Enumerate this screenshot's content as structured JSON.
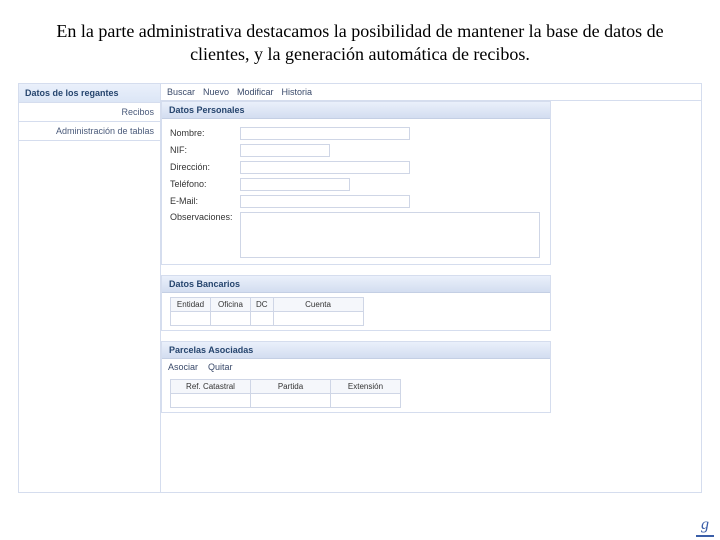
{
  "caption": "En la parte administrativa destacamos la posibilidad de mantener la base de datos de clientes, y la generación automática de recibos.",
  "sidebar": {
    "header": "Datos de los regantes",
    "items": [
      "Recibos",
      "Administración de tablas"
    ]
  },
  "toolbar": {
    "buscar": "Buscar",
    "nuevo": "Nuevo",
    "modificar": "Modificar",
    "historia": "Historia"
  },
  "sections": {
    "personales": "Datos Personales",
    "bancarios": "Datos Bancarios",
    "parcelas": "Parcelas Asociadas"
  },
  "form": {
    "nombre": "Nombre:",
    "nif": "NIF:",
    "direccion": "Dirección:",
    "telefono": "Teléfono:",
    "email": "E-Mail:",
    "obs": "Observaciones:"
  },
  "bank": {
    "entidad": "Entidad",
    "oficina": "Oficina",
    "dc": "DC",
    "cuenta": "Cuenta"
  },
  "assoc": {
    "asociar": "Asociar",
    "quitar": "Quitar",
    "ref": "Ref. Catastral",
    "partida": "Partida",
    "extension": "Extensión"
  }
}
